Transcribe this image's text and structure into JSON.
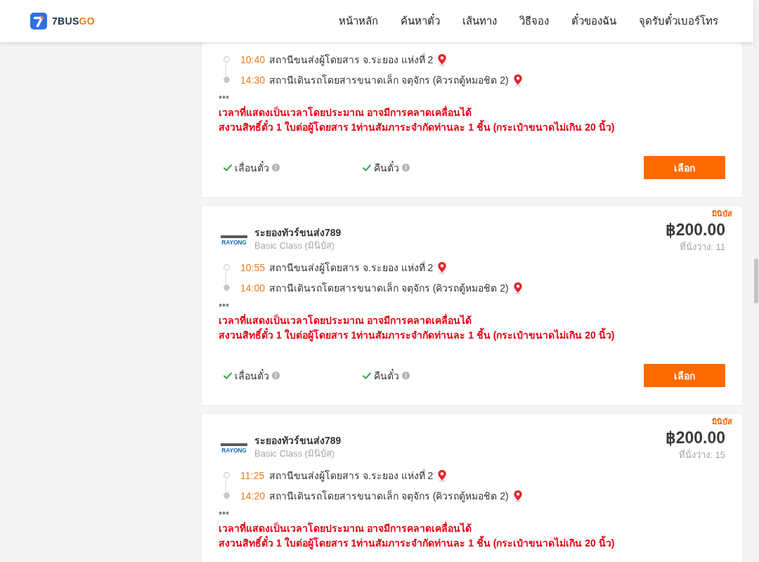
{
  "header": {
    "brand": {
      "name": "7BUS",
      "accent": "GO"
    },
    "nav": [
      {
        "label": "หน้าหลัก"
      },
      {
        "label": "ค้นหาตั๋ว"
      },
      {
        "label": "เส้นทาง"
      },
      {
        "label": "วิธีจอง"
      },
      {
        "label": "ตั๋วของฉัน"
      },
      {
        "label": "จุดรับตั๋วเบอร์โทร"
      }
    ]
  },
  "trips": [
    {
      "stops": [
        {
          "kind": "departure",
          "time": "10:40",
          "station": "สถานีขนส่งผู้โดยสาร จ.ระยอง แห่งที่ 2"
        },
        {
          "kind": "arrival",
          "time": "14:30",
          "station": "สถานีเดินรถโดยสารขนาดเล็ก จตุจักร (คิวรถตู้หมอชิต 2)"
        }
      ],
      "note_mark": "***",
      "notes": [
        "เวลาที่แสดงเป็นเวลาโดยประมาณ อาจมีการคลาดเคลื่อนได้",
        "สงวนสิทธิ์ตั๋ว 1 ใบต่อผู้โดยสาร 1ท่านสัมภาระจำกัดท่านละ 1 ชิ้น (กระเป๋าขนาดไม่เกิน 20 นิ้ว)"
      ],
      "features": [
        {
          "label": "เลื่อนตั๋ว",
          "available": true
        },
        {
          "label": "คืนตั๋ว",
          "available": true
        }
      ],
      "button": "เลือก"
    },
    {
      "tag": "มินิบัส",
      "operator": {
        "logo": "RAYONG",
        "name": "ระยองทัวร์ขนส่ง789",
        "class": "Basic Class (มินิบัส)"
      },
      "price": "฿200.00",
      "seats": "ที่นั่งว่าง: 11",
      "stops": [
        {
          "kind": "departure",
          "time": "10:55",
          "station": "สถานีขนส่งผู้โดยสาร จ.ระยอง แห่งที่ 2"
        },
        {
          "kind": "arrival",
          "time": "14:00",
          "station": "สถานีเดินรถโดยสารขนาดเล็ก จตุจักร (คิวรถตู้หมอชิต 2)"
        }
      ],
      "note_mark": "***",
      "notes": [
        "เวลาที่แสดงเป็นเวลาโดยประมาณ อาจมีการคลาดเคลื่อนได้",
        "สงวนสิทธิ์ตั๋ว 1 ใบต่อผู้โดยสาร 1ท่านสัมภาระจำกัดท่านละ 1 ชิ้น (กระเป๋าขนาดไม่เกิน 20 นิ้ว)"
      ],
      "features": [
        {
          "label": "เลื่อนตั๋ว",
          "available": true
        },
        {
          "label": "คืนตั๋ว",
          "available": true
        }
      ],
      "button": "เลือก"
    },
    {
      "tag": "มินิบัส",
      "operator": {
        "logo": "RAYONG",
        "name": "ระยองทัวร์ขนส่ง789",
        "class": "Basic Class (มินิบัส)"
      },
      "price": "฿200.00",
      "seats": "ที่นั่งว่าง: 15",
      "stops": [
        {
          "kind": "departure",
          "time": "11:25",
          "station": "สถานีขนส่งผู้โดยสาร จ.ระยอง แห่งที่ 2"
        },
        {
          "kind": "arrival",
          "time": "14:20",
          "station": "สถานีเดินรถโดยสารขนาดเล็ก จตุจักร (คิวรถตู้หมอชิต 2)"
        }
      ],
      "note_mark": "***",
      "notes": [
        "เวลาที่แสดงเป็นเวลาโดยประมาณ อาจมีการคลาดเคลื่อนได้",
        "สงวนสิทธิ์ตั๋ว 1 ใบต่อผู้โดยสาร 1ท่านสัมภาระจำกัดท่านละ 1 ชิ้น (กระเป๋าขนาดไม่เกิน 20 นิ้ว)"
      ]
    }
  ]
}
